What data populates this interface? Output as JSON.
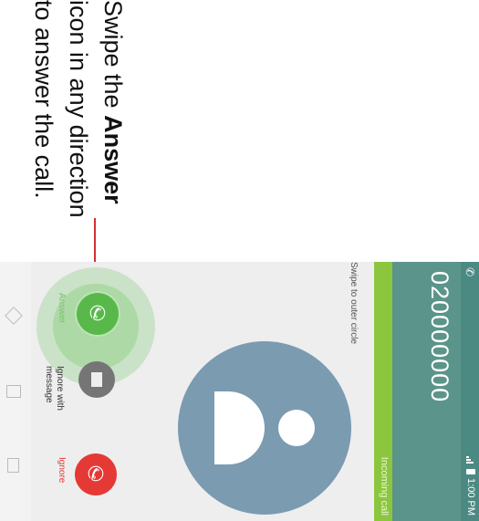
{
  "instruction": {
    "line1_pre": "Swipe the ",
    "line1_bold": "Answer",
    "line2": "icon in any direction",
    "line3": "to answer the call."
  },
  "status_bar": {
    "time": "1:00 PM",
    "call_icon": "phone-icon"
  },
  "caller": {
    "number": "020000000",
    "status": "Incoming call"
  },
  "avatar": {
    "icon": "person-icon"
  },
  "hint": "Swipe to outer circle",
  "actions": {
    "answer_label": "Answer",
    "ignore_message_label_1": "Ignore with",
    "ignore_message_label_2": "message",
    "ignore_label": "Ignore"
  },
  "colors": {
    "header": "#5b948a",
    "incoming_bar": "#8cc63f",
    "answer": "#58b94a",
    "ignore": "#e53935",
    "callout": "#d32f2f"
  }
}
